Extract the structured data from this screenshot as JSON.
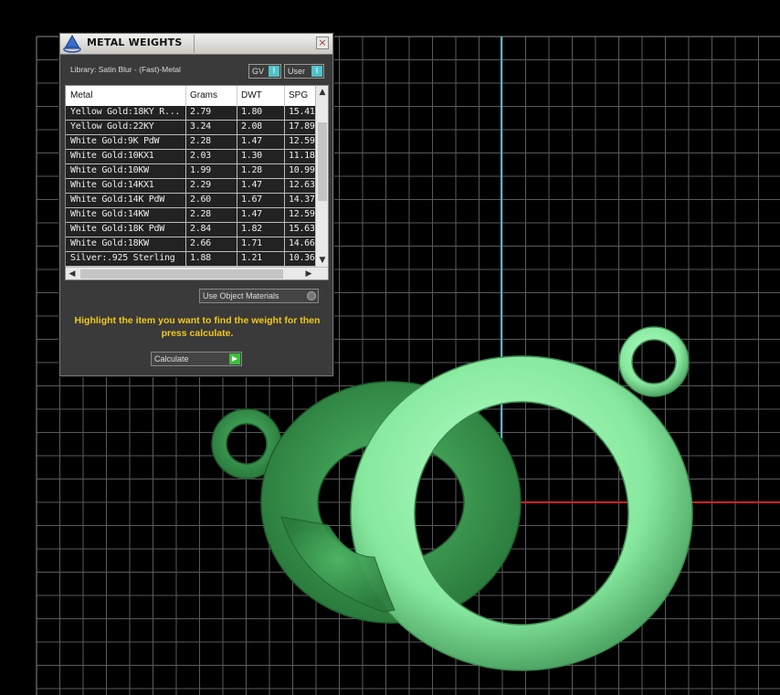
{
  "dialog": {
    "title": "METAL WEIGHTS",
    "close_glyph": "×",
    "library_label": "Library: Satin Blur - (Fast)-Metal",
    "gv_toggle": {
      "label": "GV",
      "knob": "I"
    },
    "user_toggle": {
      "label": "User",
      "knob": "I"
    },
    "table": {
      "columns": [
        "Metal",
        "Grams",
        "DWT",
        "SPG"
      ],
      "rows": [
        [
          "Yellow Gold:18KY R...",
          "2.79",
          "1.80",
          "15.41"
        ],
        [
          "Yellow Gold:22KY",
          "3.24",
          "2.08",
          "17.89"
        ],
        [
          "White Gold:9K PdW",
          "2.28",
          "1.47",
          "12.59"
        ],
        [
          "White Gold:10KX1",
          "2.03",
          "1.30",
          "11.18"
        ],
        [
          "White Gold:10KW",
          "1.99",
          "1.28",
          "10.99"
        ],
        [
          "White Gold:14KX1",
          "2.29",
          "1.47",
          "12.63"
        ],
        [
          "White Gold:14K PdW",
          "2.60",
          "1.67",
          "14.37"
        ],
        [
          "White Gold:14KW",
          "2.28",
          "1.47",
          "12.59"
        ],
        [
          "White Gold:18K PdW",
          "2.84",
          "1.82",
          "15.63"
        ],
        [
          "White Gold:18KW",
          "2.66",
          "1.71",
          "14.66"
        ],
        [
          "Silver:.925 Sterling",
          "1.88",
          "1.21",
          "10.36"
        ]
      ]
    },
    "use_object_materials": "Use Object Materials",
    "instructions": "Highlight the item you want to find the weight for then press calculate.",
    "calculate_label": "Calculate"
  },
  "colors": {
    "grid": "#5a5a5a",
    "axis_y": "#5fb3bf",
    "axis_x": "#d02020",
    "ring_dark": "#3a9a52",
    "ring_light": "#8ef0a6",
    "accent_cyan": "#4ec3c8",
    "instruction_yellow": "#f2c81a"
  }
}
